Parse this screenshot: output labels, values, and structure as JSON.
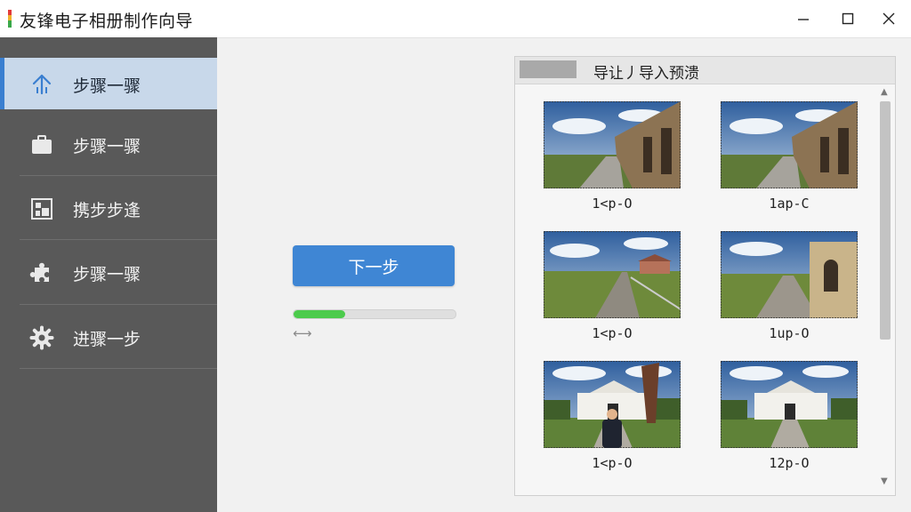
{
  "window": {
    "title": "友锋电子相册制作向导",
    "minimize_icon": "minimize-icon",
    "maximize_icon": "maximize-icon",
    "close_icon": "close-icon"
  },
  "sidebar": {
    "items": [
      {
        "label": "步骤一骤",
        "icon": "upload-icon",
        "active": true
      },
      {
        "label": "步骤一骤",
        "icon": "briefcase-icon",
        "active": false
      },
      {
        "label": "携步步逢",
        "icon": "layout-icon",
        "active": false
      },
      {
        "label": "步骤一骤",
        "icon": "puzzle-icon",
        "active": false
      },
      {
        "label": "进骤一步",
        "icon": "gear-icon",
        "active": false
      }
    ]
  },
  "main": {
    "next_button": "下一步",
    "progress": 0.32,
    "progress_caption": "⟷"
  },
  "preview": {
    "title": "导让丿导入预溃",
    "thumbnails": [
      {
        "caption": "1<p-O",
        "scene": "corridor"
      },
      {
        "caption": "1ap-C",
        "scene": "corridor"
      },
      {
        "caption": "1<p-O",
        "scene": "road"
      },
      {
        "caption": "1up-O",
        "scene": "road-house"
      },
      {
        "caption": "1<p-O",
        "scene": "mansion-person"
      },
      {
        "caption": "12p-O",
        "scene": "mansion"
      }
    ]
  },
  "colors": {
    "sidebar_bg": "#595959",
    "active_item_bg": "#c8d8ea",
    "accent": "#3f86d4",
    "progress": "#4ccb4c"
  }
}
